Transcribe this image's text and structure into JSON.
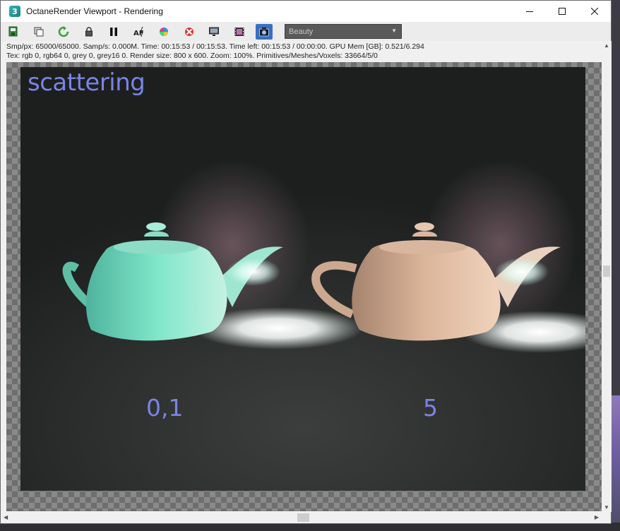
{
  "window": {
    "title": "OctaneRender Viewport - Rendering",
    "app_icon_glyph": "3",
    "controls": [
      "minimize",
      "maximize",
      "close"
    ]
  },
  "toolbar": {
    "buttons": [
      {
        "icon": "save-render-icon"
      },
      {
        "icon": "clone-icon"
      },
      {
        "icon": "restart-render-icon"
      },
      {
        "icon": "lock-icon"
      },
      {
        "icon": "pause-icon"
      },
      {
        "icon": "autofocus-icon"
      },
      {
        "icon": "color-picker-icon"
      },
      {
        "icon": "clear-region-icon"
      },
      {
        "icon": "display-icon"
      },
      {
        "icon": "film-region-icon"
      },
      {
        "icon": "camera-icon"
      }
    ],
    "render_pass": {
      "selected": "Beauty"
    }
  },
  "status": {
    "line1": "Smp/px: 65000/65000.   Samp/s: 0.000M.   Time: 00:15:53 / 00:15:53.   Time left: 00:15:53 / 00:00:00.   GPU Mem [GB]: 0.521/6.294",
    "line2": "Tex: rgb 0, rgb64 0, grey 0, grey16 0.   Render size: 800 x 600.   Zoom: 100%.   Primitives/Meshes/Voxels: 33664/5/0"
  },
  "render": {
    "title": "scattering",
    "label_left": "0,1",
    "label_right": "5",
    "colors": {
      "label": "#7b83e6",
      "teapot_left": "#6fd9c0",
      "teapot_right": "#d9b49a"
    }
  }
}
